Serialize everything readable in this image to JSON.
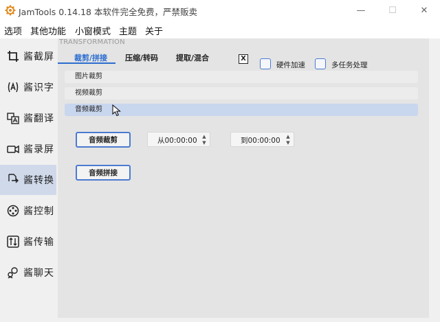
{
  "window": {
    "title": "JamTools 0.14.18 本软件完全免费，严禁贩卖",
    "minimize_glyph": "—",
    "maximize_glyph": "☐",
    "close_glyph": "✕",
    "app_icon": "jamtools-logo-icon"
  },
  "menubar": {
    "items": [
      "选项",
      "其他功能",
      "小窗模式",
      "主题",
      "关于"
    ]
  },
  "sidebar": {
    "items": [
      {
        "label": "酱截屏",
        "icon": "crop-icon",
        "active": false
      },
      {
        "label": "酱识字",
        "icon": "text-recognize-icon",
        "active": false
      },
      {
        "label": "酱翻译",
        "icon": "translate-icon",
        "active": false
      },
      {
        "label": "酱录屏",
        "icon": "record-icon",
        "active": false
      },
      {
        "label": "酱转换",
        "icon": "convert-icon",
        "active": true
      },
      {
        "label": "酱控制",
        "icon": "control-icon",
        "active": false
      },
      {
        "label": "酱传输",
        "icon": "transfer-icon",
        "active": false
      },
      {
        "label": "酱聊天",
        "icon": "chat-icon",
        "active": false
      }
    ]
  },
  "panel": {
    "caption": "TRANSFORMATION",
    "tabs": [
      "裁剪/拼接",
      "压缩/转码",
      "提取/混合"
    ],
    "close_label": "X",
    "hardware_accel_label": "硬件加速",
    "multitask_label": "多任务处理",
    "list": [
      "图片裁剪",
      "视频裁剪",
      "音频裁剪"
    ],
    "selected_index": 2,
    "audio_cut_button": "音频裁剪",
    "audio_join_button": "音频拼接",
    "from_time": "从00:00:00",
    "to_time": "到00:00:00",
    "spin_up_glyph": "▲",
    "spin_down_glyph": "▼"
  },
  "colors": {
    "accent": "#2a6ccf",
    "selected_row": "#c8d6ee",
    "sidebar_active": "#cfd9ea",
    "panel_bg": "#e4e4e4"
  }
}
